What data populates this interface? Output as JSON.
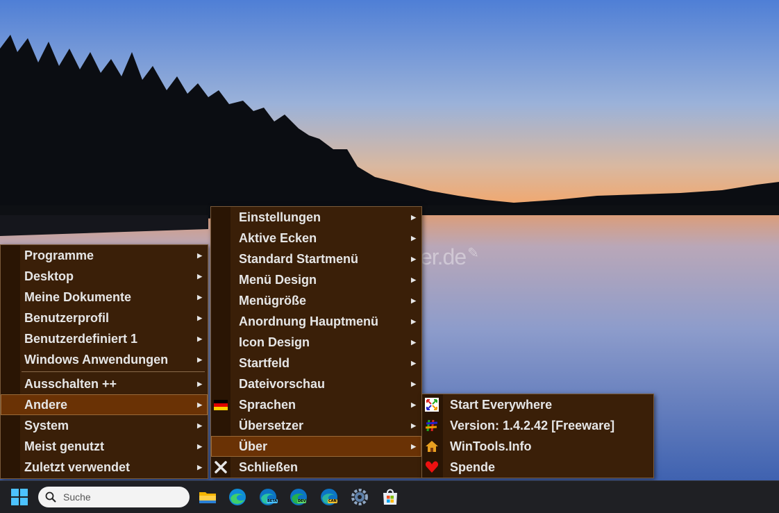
{
  "watermark": "Deskmodder.de",
  "main_menu": {
    "items": [
      {
        "label": "Programme",
        "submenu": true
      },
      {
        "label": "Desktop",
        "submenu": true
      },
      {
        "label": "Meine Dokumente",
        "submenu": true
      },
      {
        "label": "Benutzerprofil",
        "submenu": true
      },
      {
        "label": "Benutzerdefiniert 1",
        "submenu": true
      },
      {
        "label": "Windows Anwendungen",
        "submenu": true
      },
      {
        "label": "Ausschalten ++",
        "submenu": true
      },
      {
        "label": "Andere",
        "submenu": true,
        "selected": true
      },
      {
        "label": "System",
        "submenu": true
      },
      {
        "label": "Meist genutzt",
        "submenu": true
      },
      {
        "label": "Zuletzt verwendet",
        "submenu": true
      }
    ]
  },
  "andere_menu": {
    "items": [
      {
        "label": "Einstellungen",
        "submenu": true
      },
      {
        "label": "Aktive Ecken",
        "submenu": true
      },
      {
        "label": "Standard Startmenü",
        "submenu": true
      },
      {
        "label": "Menü Design",
        "submenu": true
      },
      {
        "label": "Menügröße",
        "submenu": true
      },
      {
        "label": "Anordnung Hauptmenü",
        "submenu": true
      },
      {
        "label": "Icon Design",
        "submenu": true
      },
      {
        "label": "Startfeld",
        "submenu": true
      },
      {
        "label": "Dateivorschau",
        "submenu": true
      },
      {
        "label": "Sprachen",
        "submenu": true,
        "icon": "german-flag-icon"
      },
      {
        "label": "Übersetzer",
        "submenu": true
      },
      {
        "label": "Über",
        "submenu": true,
        "selected": true
      },
      {
        "label": "Schließen",
        "submenu": false,
        "icon": "close-x-icon"
      }
    ]
  },
  "ueber_menu": {
    "items": [
      {
        "label": "Start Everywhere",
        "icon": "start-everywhere-icon"
      },
      {
        "label": "Version: 1.4.2.42 [Freeware]",
        "icon": "version-icon"
      },
      {
        "label": "WinTools.Info",
        "icon": "home-icon"
      },
      {
        "label": "Spende",
        "icon": "heart-icon"
      }
    ]
  },
  "taskbar": {
    "search_placeholder": "Suche",
    "badges": {
      "beta": "BETA",
      "dev": "DEV",
      "can": "CAN"
    },
    "apps": [
      "windows-start-icon",
      "file-explorer-icon",
      "edge-icon",
      "edge-beta-icon",
      "edge-dev-icon",
      "edge-canary-icon",
      "settings-icon",
      "store-icon"
    ]
  },
  "colors": {
    "menu_bg": "#3a1f08",
    "menu_selected": "#6a3205",
    "menu_text": "#e6e6e6",
    "taskbar_bg": "#1f2024"
  }
}
